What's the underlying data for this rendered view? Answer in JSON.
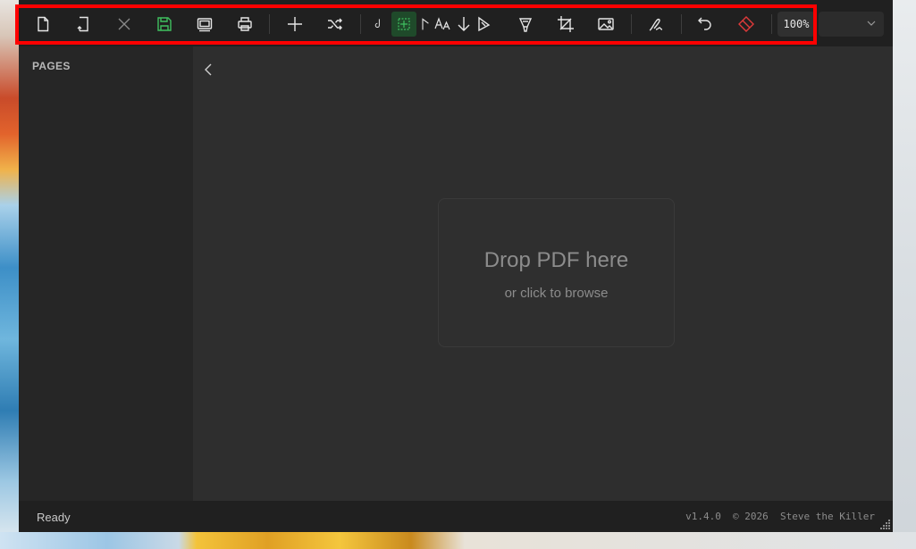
{
  "toolbar": {
    "zoom_level": "100%",
    "dropdown_value": "",
    "buttons": [
      {
        "name": "new-document-icon",
        "color": "#e6e6e6"
      },
      {
        "name": "rotate-page-icon",
        "color": "#e6e6e6"
      },
      {
        "name": "close-icon",
        "color": "#8a8a8a"
      },
      {
        "name": "save-icon",
        "color": "#3fbf5f"
      },
      {
        "name": "fit-page-icon",
        "color": "#e6e6e6"
      },
      {
        "name": "print-icon",
        "color": "#e6e6e6"
      },
      {
        "name": "add-icon",
        "color": "#e6e6e6"
      },
      {
        "name": "shuffle-icon",
        "color": "#e6e6e6"
      },
      {
        "name": "grid-select-icon",
        "color": "#3fbf5f"
      },
      {
        "name": "text-size-icon",
        "color": "#e6e6e6"
      },
      {
        "name": "arrow-down-icon",
        "color": "#e6e6e6"
      },
      {
        "name": "highlighter-icon",
        "color": "#e6e6e6"
      },
      {
        "name": "marker-icon",
        "color": "#e6e6e6"
      },
      {
        "name": "crop-icon",
        "color": "#e6e6e6"
      },
      {
        "name": "image-icon",
        "color": "#e6e6e6"
      },
      {
        "name": "signature-icon",
        "color": "#e6e6e6"
      },
      {
        "name": "undo-icon",
        "color": "#e6e6e6"
      },
      {
        "name": "erase-icon",
        "color": "#e03a3a"
      }
    ]
  },
  "sidebar": {
    "title": "PAGES"
  },
  "dropzone": {
    "title": "Drop PDF here",
    "subtitle": "or click to browse"
  },
  "status": {
    "text": "Ready",
    "version_info": "v1.4.0  © 2026  Steve the Killer"
  }
}
